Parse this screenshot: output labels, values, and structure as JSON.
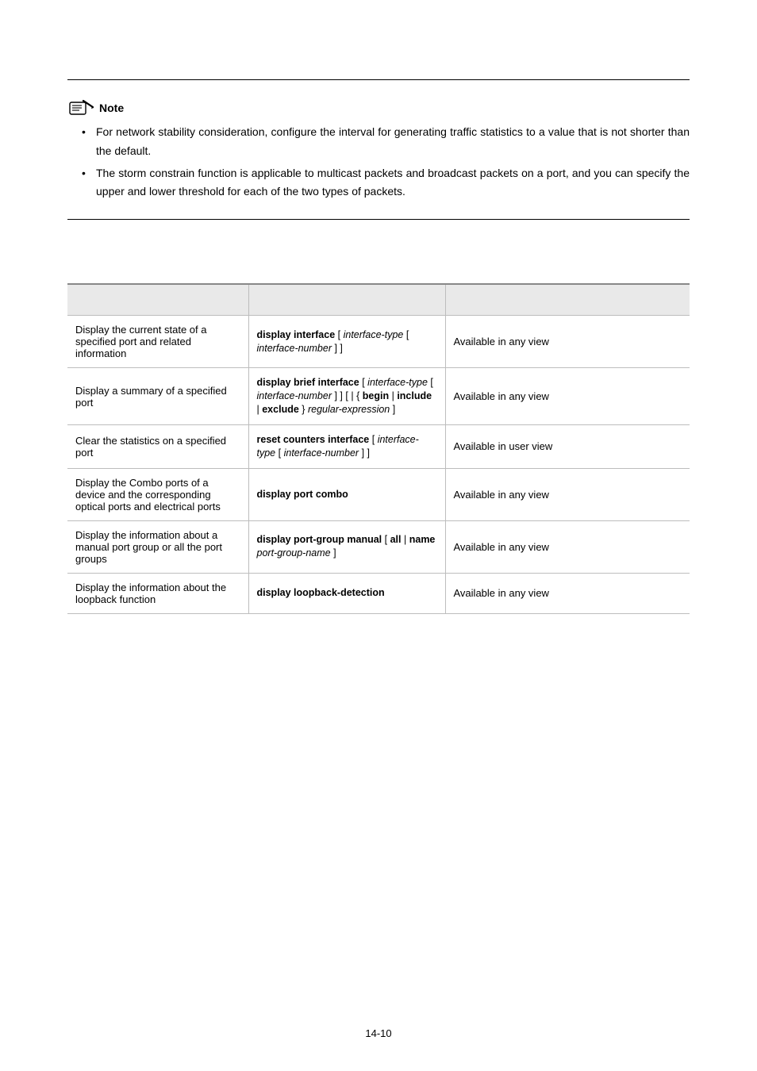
{
  "note": {
    "label": "Note",
    "bullets": [
      "For network stability consideration, configure the interval for generating traffic statistics to a value that is not shorter than the default.",
      "The storm constrain function is applicable to multicast packets and broadcast packets on a port, and you can specify the upper and lower threshold for each of the two types of packets."
    ]
  },
  "table": {
    "headers": [
      "",
      "",
      ""
    ],
    "rows": [
      {
        "todo": "Display the current state of a specified port and related information",
        "desc": "Available in any view",
        "cmd_html": "<span class='b'>display interface</span> <span class='p'>[</span> <span class='i'>interface-type</span> <span class='p'>[</span> <span class='i'>interface-number</span> <span class='p'>] ]</span>"
      },
      {
        "todo": "Display a summary of a specified port",
        "desc": "Available in any view",
        "cmd_html": "<span class='b'>display brief interface</span> <span class='p'>[</span> <span class='i'>interface-type</span> <span class='p'>[</span> <span class='i'>interface-number</span> <span class='p'>] ] [</span> <span class='p'>|</span> <span class='p'>{</span> <span class='b'>begin</span> <span class='p'>|</span> <span class='b'>include</span> <span class='p'>|</span> <span class='b'>exclude</span> <span class='p'>}</span> <span class='i'>regular-expression</span> <span class='p'>]</span>"
      },
      {
        "todo": "Clear the statistics on a specified port",
        "desc": "Available in user view",
        "cmd_html": "<span class='b'>reset counters interface</span> <span class='p'>[</span> <span class='i'>interface-type</span> <span class='p'>[</span> <span class='i'>interface-number</span> <span class='p'>] ]</span>"
      },
      {
        "todo": "Display the Combo ports of a device and the corresponding optical ports and electrical ports",
        "desc": "Available in any view",
        "cmd_html": "<span class='b'>display port combo</span>"
      },
      {
        "todo": "Display the information about a manual port group or all the port groups",
        "desc": "Available in any view",
        "cmd_html": "<span class='b'>display port-group manual</span> <span class='p'>[</span> <span class='b'>all</span> <span class='p'>|</span> <span class='b'>name</span> <span class='i'>port-group-name</span> <span class='p'>]</span>"
      },
      {
        "todo": "Display the information about the loopback function",
        "desc": "Available in any view",
        "cmd_html": "<span class='b'>display loopback-detection</span>"
      }
    ]
  },
  "page_number": "14-10"
}
